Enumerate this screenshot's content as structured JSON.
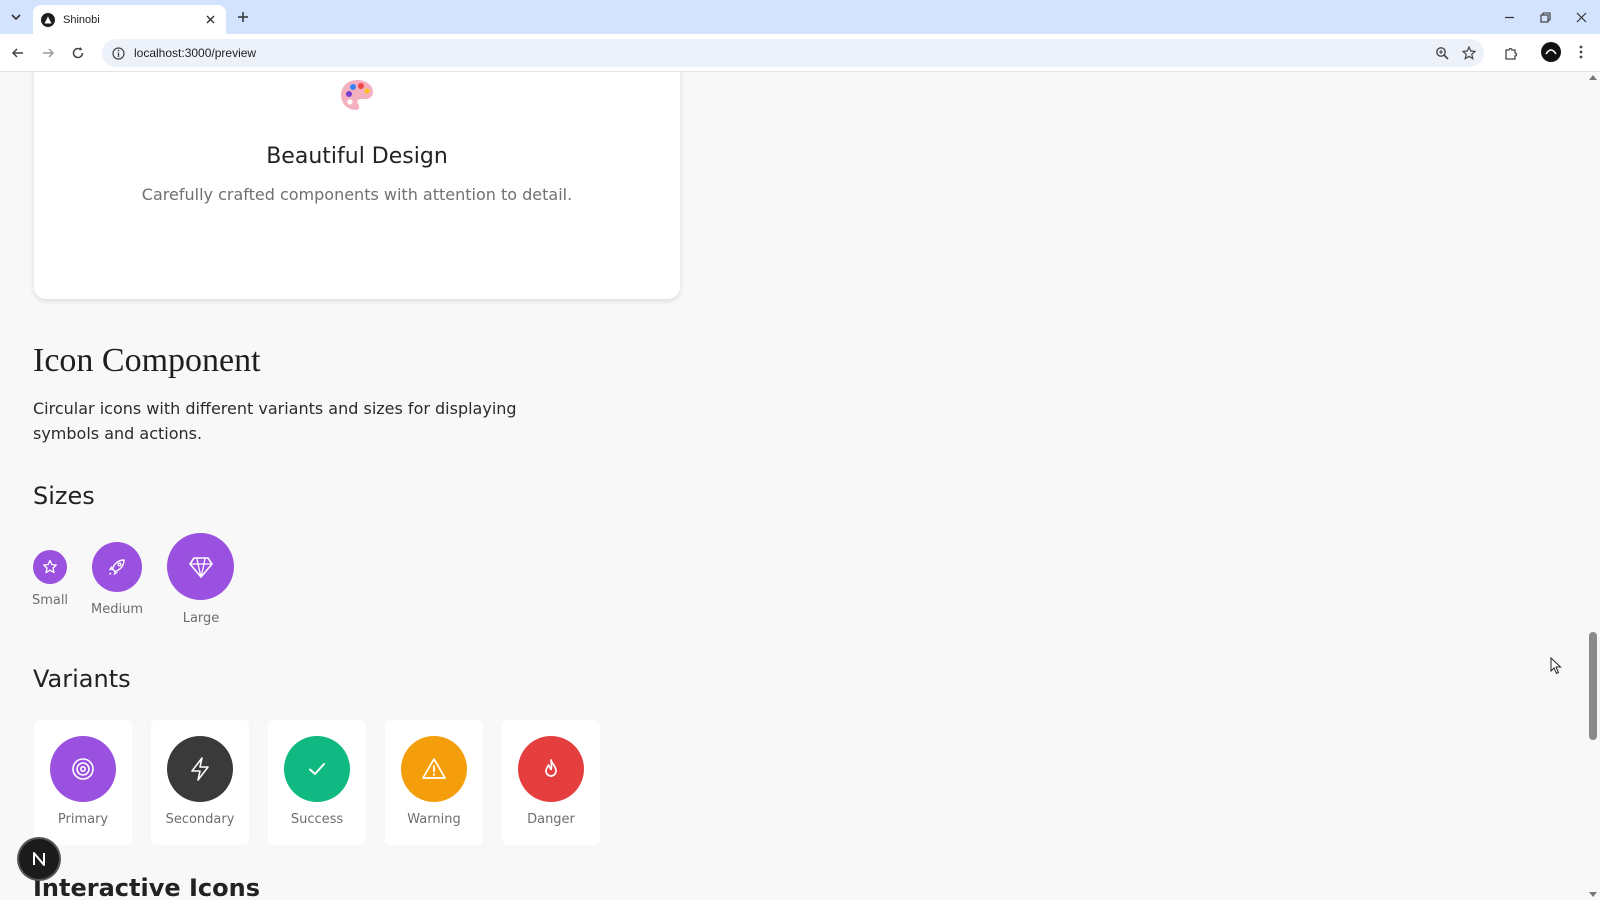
{
  "browser": {
    "tab_title": "Shinobi",
    "url": "localhost:3000/preview"
  },
  "feature_card": {
    "title": "Beautiful Design",
    "description": "Carefully crafted components with attention to detail."
  },
  "icon_section": {
    "title": "Icon Component",
    "description": "Circular icons with different variants and sizes for displaying symbols and actions.",
    "sizes_heading": "Sizes",
    "sizes": [
      {
        "label": "Small",
        "icon": "star-icon"
      },
      {
        "label": "Medium",
        "icon": "rocket-icon"
      },
      {
        "label": "Large",
        "icon": "diamond-icon"
      }
    ],
    "variants_heading": "Variants",
    "variants": [
      {
        "label": "Primary",
        "icon": "target-icon",
        "color": "#9b51e0"
      },
      {
        "label": "Secondary",
        "icon": "lightning-icon",
        "color": "#3a3a3a"
      },
      {
        "label": "Success",
        "icon": "check-icon",
        "color": "#10b981"
      },
      {
        "label": "Warning",
        "icon": "warning-icon",
        "color": "#f59e0b"
      },
      {
        "label": "Danger",
        "icon": "flame-icon",
        "color": "#e53e3e"
      }
    ],
    "next_heading": "Interactive Icons",
    "primary_color": "#9b51e0"
  },
  "dev_badge": {
    "letter": "N"
  }
}
